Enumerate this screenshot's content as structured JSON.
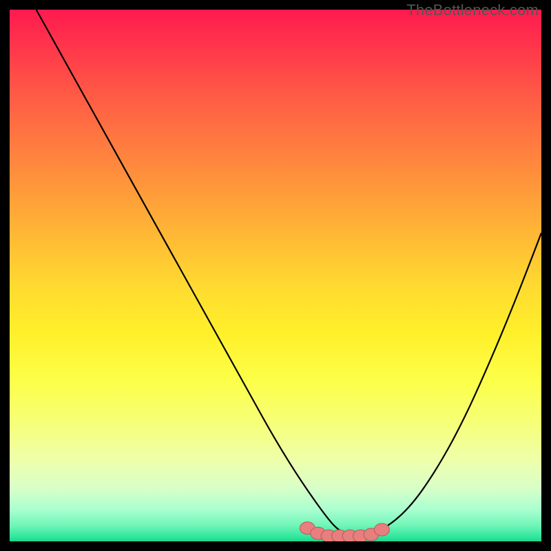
{
  "watermark": "TheBottleneck.com",
  "colors": {
    "background": "#000000",
    "curve": "#000000",
    "marker_fill": "#e97e7e",
    "marker_stroke": "#b85a5a"
  },
  "chart_data": {
    "type": "line",
    "title": "",
    "xlabel": "",
    "ylabel": "",
    "xlim": [
      0,
      100
    ],
    "ylim": [
      0,
      100
    ],
    "series": [
      {
        "name": "curve",
        "x": [
          5,
          10,
          15,
          20,
          25,
          30,
          35,
          40,
          45,
          50,
          55,
          60,
          62,
          64,
          66,
          70,
          75,
          80,
          85,
          90,
          95,
          100
        ],
        "y": [
          100,
          91,
          82,
          73,
          64,
          55,
          46,
          37,
          28,
          19,
          11,
          4,
          2,
          1,
          1,
          2,
          6,
          13,
          22,
          33,
          45,
          58
        ]
      }
    ],
    "markers": {
      "name": "highlight-band",
      "x": [
        56,
        58,
        60,
        62,
        64,
        66,
        68,
        70
      ],
      "y": [
        2.5,
        1.5,
        1.0,
        1.0,
        1.0,
        1.0,
        1.3,
        2.2
      ]
    }
  }
}
